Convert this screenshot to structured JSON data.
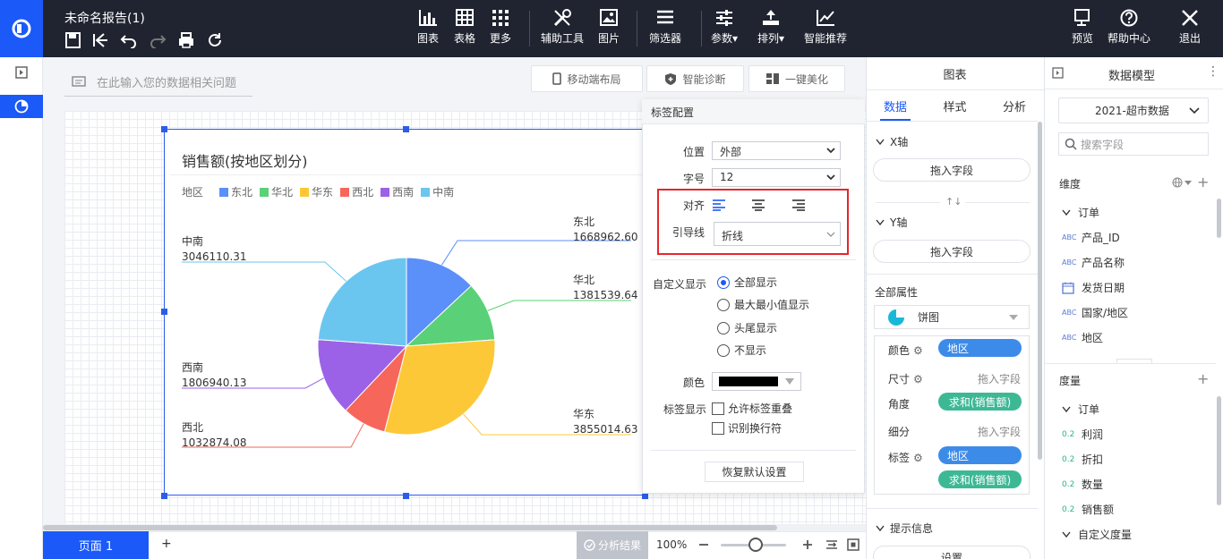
{
  "header": {
    "title": "未命名报告(1)",
    "tools": [
      {
        "id": "chart",
        "label": "图表"
      },
      {
        "id": "table",
        "label": "表格"
      },
      {
        "id": "more",
        "label": "更多"
      },
      {
        "id": "aux",
        "label": "辅助工具"
      },
      {
        "id": "image",
        "label": "图片"
      },
      {
        "id": "filter",
        "label": "筛选器"
      },
      {
        "id": "params",
        "label": "参数▾"
      },
      {
        "id": "sort",
        "label": "排列▾"
      },
      {
        "id": "recommend",
        "label": "智能推荐"
      }
    ],
    "right": [
      {
        "id": "preview",
        "label": "预览"
      },
      {
        "id": "help",
        "label": "帮助中心"
      },
      {
        "id": "exit",
        "label": "退出"
      }
    ]
  },
  "question_bar": {
    "placeholder": "在此输入您的数据相关问题"
  },
  "canvas_buttons": {
    "mobile": "移动端布局",
    "diagnose": "智能诊断",
    "beautify": "一键美化"
  },
  "chart_data": {
    "type": "pie",
    "title": "销售额(按地区划分)",
    "legend_title": "地区",
    "legend_placement": "top-left",
    "categories": [
      "东北",
      "华北",
      "华东",
      "西北",
      "西南",
      "中南"
    ],
    "values": [
      1668962.6,
      1381539.64,
      3855014.63,
      1032874.08,
      1806940.13,
      3046110.31
    ],
    "value_labels": [
      "1668962.60",
      "1381539.64",
      "3855014.63",
      "1032874.08",
      "1806940.13",
      "3046110.31"
    ],
    "colors": [
      "#5b8ff9",
      "#5ad178",
      "#fdc837",
      "#f6665a",
      "#9b62e7",
      "#6bc6ef"
    ]
  },
  "label_config": {
    "title": "标签配置",
    "position_label": "位置",
    "position_value": "外部",
    "fontsize_label": "字号",
    "fontsize_value": "12",
    "align_label": "对齐",
    "leader_label": "引导线",
    "leader_value": "折线",
    "custom_label": "自定义显示",
    "options": [
      "全部显示",
      "最大最小值显示",
      "头尾显示",
      "不显示"
    ],
    "selected": "全部显示",
    "color_label": "颜色",
    "color_value": "#000000",
    "display_label": "标签显示",
    "checks": [
      "允许标签重叠",
      "识别换行符"
    ],
    "reset": "恢复默认设置"
  },
  "chart_panel": {
    "title": "图表",
    "tabs": [
      "数据",
      "样式",
      "分析"
    ],
    "x_axis": "X轴",
    "y_axis": "Y轴",
    "drop_field": "拖入字段",
    "all_props": "全部属性",
    "chart_type": "饼图",
    "rows": {
      "color": "颜色",
      "size": "尺寸",
      "angle": "角度",
      "detail": "细分",
      "label": "标签"
    },
    "pill_region": "地区",
    "pill_sum": "求和(销售额)",
    "drop_hint": "拖入字段",
    "tooltip": "提示信息",
    "settings": "设置"
  },
  "model_panel": {
    "title": "数据模型",
    "dataset": "2021-超市数据",
    "search_placeholder": "搜索字段",
    "dimension": "维度",
    "dim_group": "订单",
    "dim_fields": [
      {
        "type": "ABC",
        "name": "产品_ID"
      },
      {
        "type": "ABC",
        "name": "产品名称"
      },
      {
        "type": "date",
        "name": "发货日期"
      },
      {
        "type": "ABC",
        "name": "国家/地区"
      },
      {
        "type": "ABC",
        "name": "地区"
      }
    ],
    "measure": "度量",
    "measure_group": "订单",
    "measure_fields": [
      "利润",
      "折扣",
      "数量",
      "销售额"
    ],
    "measure_type": "0.2",
    "custom_measure": "自定义度量"
  },
  "bottom": {
    "page_tab": "页面 1",
    "add": "+",
    "analysis": "分析结果",
    "zoom": "100%"
  }
}
